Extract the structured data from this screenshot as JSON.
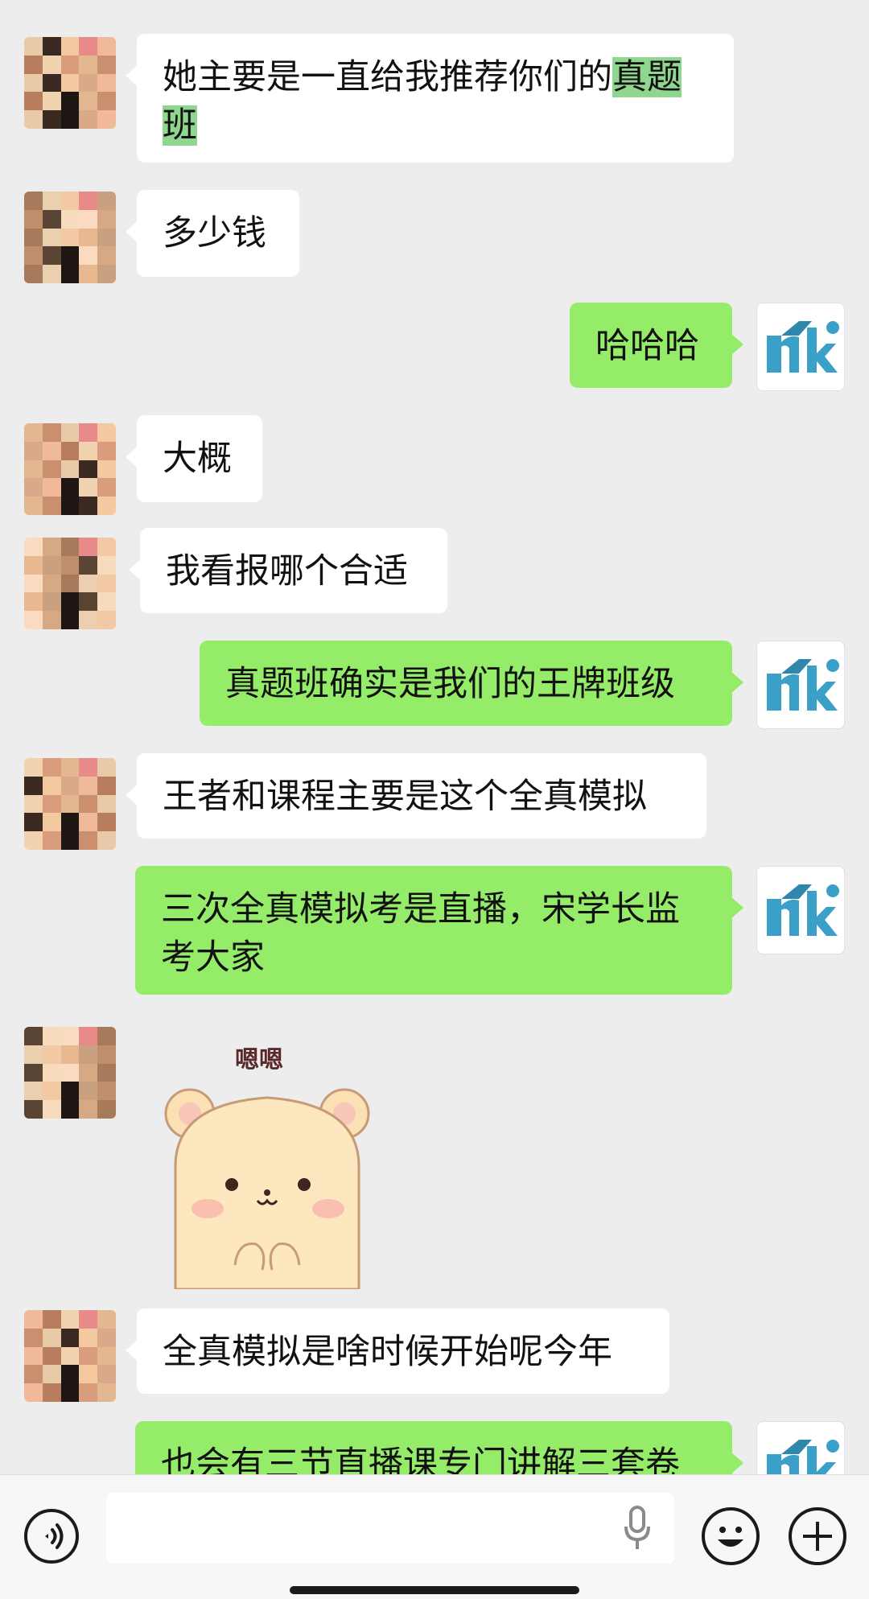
{
  "messages": [
    {
      "id": "m1",
      "dir": "in",
      "text_before": "她主要是一直给我推荐你们的",
      "text_highlight": "真题班"
    },
    {
      "id": "m2",
      "dir": "in",
      "text": "多少钱"
    },
    {
      "id": "m3",
      "dir": "out",
      "text": "哈哈哈"
    },
    {
      "id": "m4",
      "dir": "in",
      "text": "大概"
    },
    {
      "id": "m5",
      "dir": "in",
      "text": "我看报哪个合适"
    },
    {
      "id": "m6",
      "dir": "out",
      "text": "真题班确实是我们的王牌班级"
    },
    {
      "id": "m7",
      "dir": "in",
      "text": "王者和课程主要是这个全真模拟"
    },
    {
      "id": "m8",
      "dir": "out",
      "text": "三次全真模拟考是直播，宋学长监考大家"
    },
    {
      "id": "m9",
      "dir": "in",
      "sticker_caption": "嗯嗯"
    },
    {
      "id": "m10",
      "dir": "in",
      "text": "全真模拟是啥时候开始呢今年"
    },
    {
      "id": "m11",
      "dir": "out",
      "text": "也会有三节直播课专门讲解三套卷"
    }
  ],
  "colors": {
    "chat_bg": "#ededed",
    "incoming_bubble": "#ffffff",
    "outgoing_bubble": "#95ec69",
    "highlight": "#8fd68f"
  },
  "icons": {
    "voice": "voice-icon",
    "mic": "microphone-icon",
    "emoji": "emoji-icon",
    "plus": "plus-icon"
  }
}
